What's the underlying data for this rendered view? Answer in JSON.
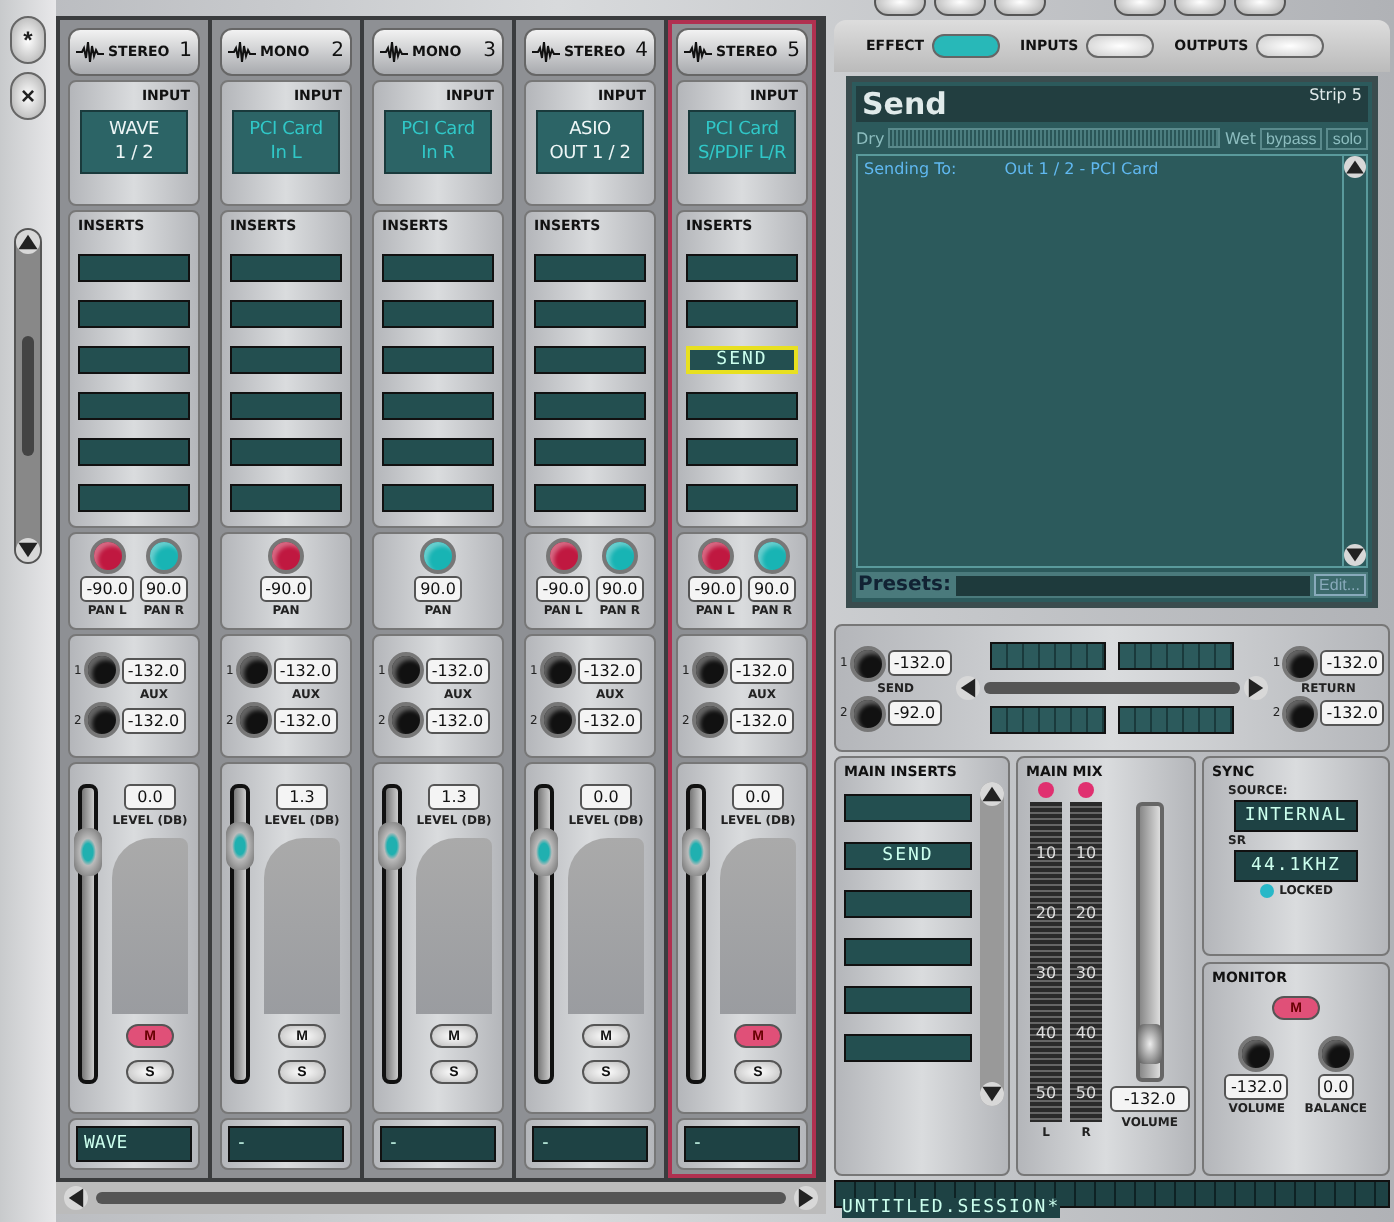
{
  "sidebar": {
    "buttons": [
      "*",
      "×"
    ]
  },
  "strips": [
    {
      "type": "STEREO",
      "number": "1",
      "selected": false,
      "input_label": "INPUT",
      "input": {
        "lines": [
          "WAVE",
          "1 / 2"
        ],
        "highlighted": false
      },
      "inserts_label": "INSERTS",
      "inserts": [
        {
          "selected": false
        },
        {
          "selected": false
        },
        {
          "selected": false
        },
        {
          "selected": false
        },
        {
          "selected": false
        },
        {
          "selected": false
        }
      ],
      "pans": [
        {
          "label": "PAN L",
          "value": "-90.0",
          "color": "#c01840"
        },
        {
          "label": "PAN R",
          "value": "90.0",
          "color": "#18b4b4"
        }
      ],
      "aux_label": "AUX",
      "aux": [
        {
          "number": "1",
          "value": "-132.0"
        },
        {
          "number": "2",
          "value": "-132.0"
        }
      ],
      "fader": {
        "value": "0.0",
        "label": "LEVEL (DB)",
        "level": 0.78
      },
      "mute": {
        "label": "M",
        "on": true
      },
      "solo": {
        "label": "S",
        "on": false
      },
      "name": "WAVE"
    },
    {
      "type": "MONO",
      "number": "2",
      "selected": false,
      "input_label": "INPUT",
      "input": {
        "lines": [
          "PCI Card",
          "In L"
        ],
        "highlighted": true
      },
      "inserts_label": "INSERTS",
      "inserts": [
        {
          "selected": false
        },
        {
          "selected": false
        },
        {
          "selected": false
        },
        {
          "selected": false
        },
        {
          "selected": false
        },
        {
          "selected": false
        }
      ],
      "pans": [
        {
          "label": "PAN",
          "value": "-90.0",
          "color": "#c01840"
        }
      ],
      "aux_label": "AUX",
      "aux": [
        {
          "number": "1",
          "value": "-132.0"
        },
        {
          "number": "2",
          "value": "-132.0"
        }
      ],
      "fader": {
        "value": "1.3",
        "label": "LEVEL (DB)",
        "level": 0.8
      },
      "mute": {
        "label": "M",
        "on": false
      },
      "solo": {
        "label": "S",
        "on": false
      },
      "name": "-"
    },
    {
      "type": "MONO",
      "number": "3",
      "selected": false,
      "input_label": "INPUT",
      "input": {
        "lines": [
          "PCI Card",
          "In R"
        ],
        "highlighted": true
      },
      "inserts_label": "INSERTS",
      "inserts": [
        {
          "selected": false
        },
        {
          "selected": false
        },
        {
          "selected": false
        },
        {
          "selected": false
        },
        {
          "selected": false
        },
        {
          "selected": false
        }
      ],
      "pans": [
        {
          "label": "PAN",
          "value": "90.0",
          "color": "#18b4b4"
        }
      ],
      "aux_label": "AUX",
      "aux": [
        {
          "number": "1",
          "value": "-132.0"
        },
        {
          "number": "2",
          "value": "-132.0"
        }
      ],
      "fader": {
        "value": "1.3",
        "label": "LEVEL (DB)",
        "level": 0.8
      },
      "mute": {
        "label": "M",
        "on": false
      },
      "solo": {
        "label": "S",
        "on": false
      },
      "name": "-"
    },
    {
      "type": "STEREO",
      "number": "4",
      "selected": false,
      "input_label": "INPUT",
      "input": {
        "lines": [
          "ASIO",
          "OUT 1 / 2"
        ],
        "highlighted": false
      },
      "inserts_label": "INSERTS",
      "inserts": [
        {
          "selected": false
        },
        {
          "selected": false
        },
        {
          "selected": false
        },
        {
          "selected": false
        },
        {
          "selected": false
        },
        {
          "selected": false
        }
      ],
      "pans": [
        {
          "label": "PAN L",
          "value": "-90.0",
          "color": "#c01840"
        },
        {
          "label": "PAN R",
          "value": "90.0",
          "color": "#18b4b4"
        }
      ],
      "aux_label": "AUX",
      "aux": [
        {
          "number": "1",
          "value": "-132.0"
        },
        {
          "number": "2",
          "value": "-132.0"
        }
      ],
      "fader": {
        "value": "0.0",
        "label": "LEVEL (DB)",
        "level": 0.78
      },
      "mute": {
        "label": "M",
        "on": false
      },
      "solo": {
        "label": "S",
        "on": false
      },
      "name": "-"
    },
    {
      "type": "STEREO",
      "number": "5",
      "selected": true,
      "input_label": "INPUT",
      "input": {
        "lines": [
          "PCI Card",
          "S/PDIF L/R"
        ],
        "highlighted": true
      },
      "inserts_label": "INSERTS",
      "inserts": [
        {
          "selected": false
        },
        {
          "selected": false
        },
        {
          "label": "SEND",
          "selected": true
        },
        {
          "selected": false
        },
        {
          "selected": false
        },
        {
          "selected": false
        }
      ],
      "pans": [
        {
          "label": "PAN L",
          "value": "-90.0",
          "color": "#c01840"
        },
        {
          "label": "PAN R",
          "value": "90.0",
          "color": "#18b4b4"
        }
      ],
      "aux_label": "AUX",
      "aux": [
        {
          "number": "1",
          "value": "-132.0"
        },
        {
          "number": "2",
          "value": "-132.0"
        }
      ],
      "fader": {
        "value": "0.0",
        "label": "LEVEL (DB)",
        "level": 0.78
      },
      "mute": {
        "label": "M",
        "on": true
      },
      "solo": {
        "label": "S",
        "on": false
      },
      "name": "-"
    }
  ],
  "modes": [
    {
      "label": "EFFECT",
      "selected": true
    },
    {
      "label": "INPUTS",
      "selected": false
    },
    {
      "label": "OUTPUTS",
      "selected": false
    }
  ],
  "effect": {
    "title": "Send",
    "strip": "Strip 5",
    "dry": "Dry",
    "dry_wet": {
      "level": 1
    },
    "wet": "Wet",
    "bypass": "bypass",
    "solo": "solo",
    "params": [
      {
        "name": "Sending To:",
        "value": "Out 1 / 2 - PCI Card"
      }
    ],
    "presets_label": "Presets:",
    "edit": "Edit..."
  },
  "send": {
    "label": "SEND",
    "knobs": [
      {
        "number": "1",
        "value": "-132.0"
      },
      {
        "number": "2",
        "value": "-92.0"
      }
    ]
  },
  "return": {
    "label": "RETURN",
    "knobs": [
      {
        "number": "1",
        "value": "-132.0"
      },
      {
        "number": "2",
        "value": "-132.0"
      }
    ]
  },
  "main_inserts": {
    "title": "MAIN INSERTS",
    "slots": [
      {
        "selected": false
      },
      {
        "label": "SEND",
        "selected": false
      },
      {
        "selected": false
      },
      {
        "selected": false
      },
      {
        "selected": false
      },
      {
        "selected": false
      }
    ]
  },
  "main_mix": {
    "title": "MAIN MIX",
    "meters": [
      {
        "label": "L",
        "scale": [
          "10",
          "20",
          "30",
          "40",
          "50"
        ]
      },
      {
        "label": "R",
        "scale": [
          "10",
          "20",
          "30",
          "40",
          "50"
        ]
      }
    ],
    "volume": "-132.0",
    "volume_label": "VOLUME",
    "level": 0.05
  },
  "sync": {
    "title": "SYNC",
    "source_label": "SOURCE:",
    "source": "INTERNAL",
    "sr_label": "SR",
    "sr": "44.1KHZ",
    "locked_label": "LOCKED",
    "locked": true
  },
  "monitor": {
    "title": "MONITOR",
    "mute": {
      "label": "M",
      "on": true
    },
    "volume": "-132.0",
    "volume_label": "VOLUME",
    "balance": "0.0",
    "balance_label": "BALANCE"
  },
  "status_bar": {
    "session": "UNTITLED.SESSION*"
  }
}
